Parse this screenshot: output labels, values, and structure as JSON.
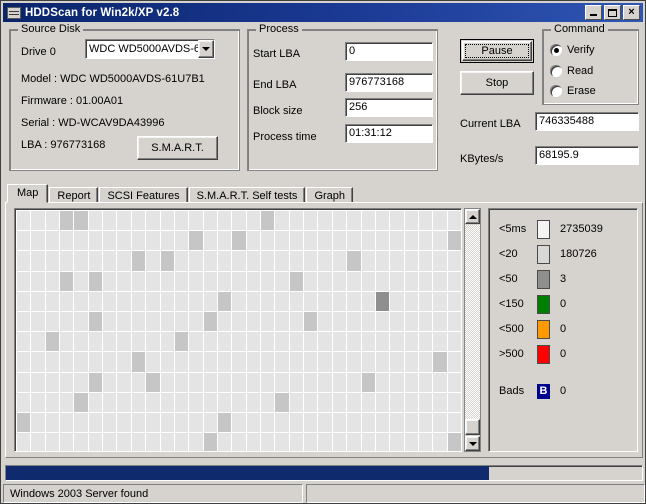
{
  "window": {
    "title": "HDDScan for Win2k/XP  v2.8",
    "icon": "app-window-icon",
    "minimize_label": "_",
    "maximize_label": "",
    "close_label": "×"
  },
  "source_disk": {
    "group_label": "Source Disk",
    "drive_label": "Drive  0",
    "drive_combo_value": "WDC WD5000AVDS-6",
    "model_label": "Model :  WDC WD5000AVDS-61U7B1",
    "firmware_label": "Firmware : 01.00A01",
    "serial_label": "Serial :     WD-WCAV9DA43996",
    "lba_label": "LBA :  976773168",
    "smart_button": "S.M.A.R.T."
  },
  "process": {
    "group_label": "Process",
    "fields": [
      {
        "label": "Start LBA",
        "value": "0"
      },
      {
        "label": "End LBA",
        "value": "976773168"
      },
      {
        "label": "Block size",
        "value": "256"
      },
      {
        "label": "Process time",
        "value": "01:31:12"
      }
    ]
  },
  "controls": {
    "pause_button": "Pause",
    "stop_button": "Stop",
    "current_lba_label": "Current LBA",
    "current_lba_value": "746335488",
    "kbytes_label": "KBytes/s",
    "kbytes_value": "68195.9"
  },
  "command": {
    "group_label": "Command",
    "options": [
      {
        "label": "Verify",
        "selected": true
      },
      {
        "label": "Read",
        "selected": false
      },
      {
        "label": "Erase",
        "selected": false
      }
    ]
  },
  "tabs": [
    {
      "label": "Map",
      "active": true
    },
    {
      "label": "Report",
      "active": false
    },
    {
      "label": "SCSI Features",
      "active": false
    },
    {
      "label": "S.M.A.R.T. Self tests",
      "active": false
    },
    {
      "label": "Graph",
      "active": false
    }
  ],
  "legend": {
    "rows": [
      {
        "name": "<5ms",
        "color": "#f4f4f4",
        "value": "2735039"
      },
      {
        "name": "<20",
        "color": "#d8d8d8",
        "value": "180726"
      },
      {
        "name": "<50",
        "color": "#8f8f8f",
        "value": "3"
      },
      {
        "name": "<150",
        "color": "#008000",
        "value": "0"
      },
      {
        "name": "<500",
        "color": "#ff9900",
        "value": "0"
      },
      {
        "name": ">500",
        "color": "#ff0000",
        "value": "0"
      }
    ],
    "bads_label": "Bads",
    "bads_badge": "B",
    "bads_badge_color": "#00008f",
    "bads_value": "0"
  },
  "map": {
    "columns": 31,
    "rows": 12,
    "colors": {
      "fast": "#e4e4e4",
      "medium": "#c6c6c6",
      "slow": "#8f8f8f",
      "empty": "#e9e9e9"
    },
    "marked_cells": [
      {
        "r": 0,
        "c": 17,
        "level": "medium"
      },
      {
        "r": 0,
        "c": 35,
        "level": "medium"
      },
      {
        "r": 0,
        "c": 3,
        "level": "medium"
      },
      {
        "r": 1,
        "c": 12,
        "level": "medium"
      },
      {
        "r": 1,
        "c": 30,
        "level": "medium"
      },
      {
        "r": 1,
        "c": 46,
        "level": "medium"
      },
      {
        "r": 2,
        "c": 8,
        "level": "medium"
      },
      {
        "r": 2,
        "c": 23,
        "level": "medium"
      },
      {
        "r": 2,
        "c": 41,
        "level": "medium"
      },
      {
        "r": 3,
        "c": 3,
        "level": "medium"
      },
      {
        "r": 3,
        "c": 19,
        "level": "medium"
      },
      {
        "r": 3,
        "c": 36,
        "level": "medium"
      },
      {
        "r": 4,
        "c": 14,
        "level": "medium"
      },
      {
        "r": 4,
        "c": 25,
        "level": "slow"
      },
      {
        "r": 5,
        "c": 5,
        "level": "medium"
      },
      {
        "r": 5,
        "c": 20,
        "level": "medium"
      },
      {
        "r": 5,
        "c": 44,
        "level": "medium"
      },
      {
        "r": 6,
        "c": 11,
        "level": "medium"
      },
      {
        "r": 6,
        "c": 33,
        "level": "medium"
      },
      {
        "r": 7,
        "c": 8,
        "level": "medium"
      },
      {
        "r": 7,
        "c": 29,
        "level": "medium"
      },
      {
        "r": 8,
        "c": 5,
        "level": "medium"
      },
      {
        "r": 8,
        "c": 24,
        "level": "medium"
      },
      {
        "r": 8,
        "c": 40,
        "level": "medium"
      },
      {
        "r": 9,
        "c": 18,
        "level": "medium"
      },
      {
        "r": 9,
        "c": 35,
        "level": "medium"
      },
      {
        "r": 10,
        "c": 14,
        "level": "medium"
      },
      {
        "r": 10,
        "c": 31,
        "level": "medium"
      },
      {
        "r": 11,
        "c": 13,
        "level": "medium"
      },
      {
        "r": 11,
        "c": 30,
        "level": "medium"
      }
    ]
  },
  "progress": {
    "percent": 76
  },
  "status": {
    "pane1": "Windows 2003 Server found",
    "pane2": ""
  }
}
